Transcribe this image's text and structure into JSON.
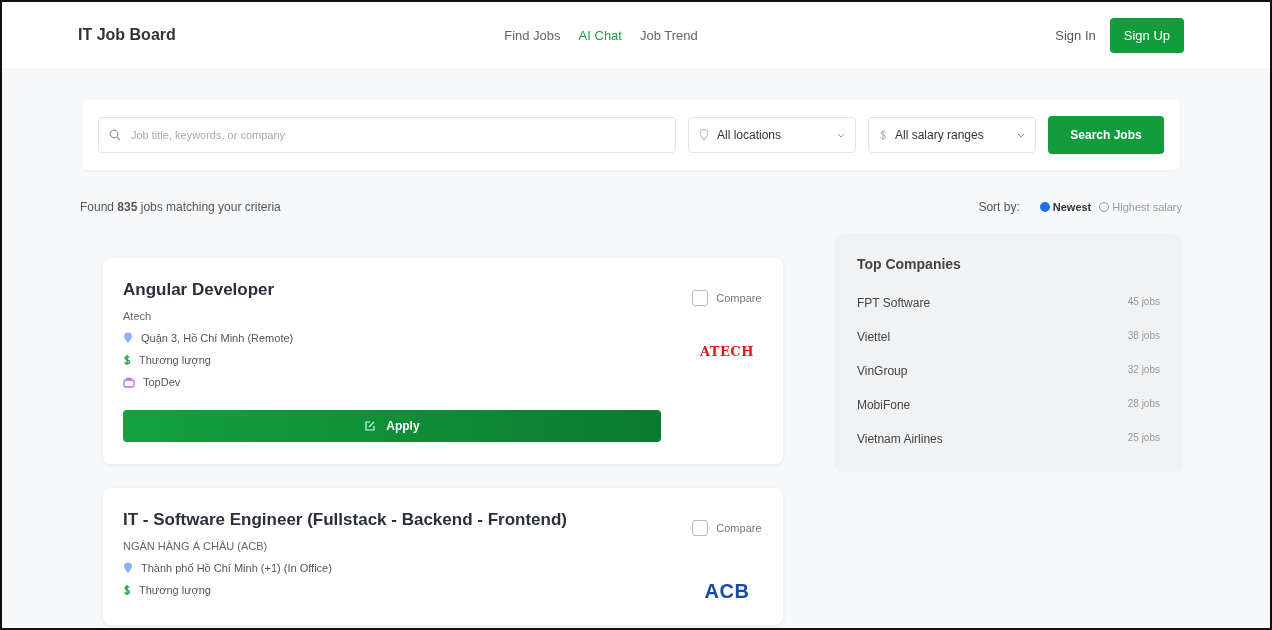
{
  "header": {
    "brand": "IT Job Board",
    "nav": [
      {
        "label": "Find Jobs",
        "selected": false
      },
      {
        "label": "AI Chat",
        "selected": true
      },
      {
        "label": "Job Trend",
        "selected": false
      }
    ],
    "sign_in": "Sign In",
    "sign_up": "Sign Up"
  },
  "search": {
    "placeholder": "Job title, keywords, or company",
    "location": "All locations",
    "salary": "All salary ranges",
    "button": "Search Jobs"
  },
  "results": {
    "prefix": "Found ",
    "count": "835",
    "suffix": " jobs matching your criteria",
    "sort_label": "Sort by:",
    "sort_options": [
      {
        "label": "Newest",
        "selected": true
      },
      {
        "label": "Highest salary",
        "selected": false
      }
    ]
  },
  "jobs": [
    {
      "title": "Angular Developer",
      "company": "Atech",
      "location": "Quận 3, Hồ Chí Minh (Remote)",
      "salary": "Thương lượng",
      "source": "TopDev",
      "apply": "Apply",
      "compare": "Compare",
      "compare_checked": false,
      "logo": "ATECH"
    },
    {
      "title": "IT - Software Engineer (Fullstack - Backend - Frontend)",
      "company": "NGÂN HÀNG Á CHÂU (ACB)",
      "location": "Thành phố Hồ Chí Minh (+1) (In Office)",
      "salary": "Thương lượng",
      "compare": "Compare",
      "compare_checked": false,
      "logo": "ACB"
    }
  ],
  "top_companies": {
    "title": "Top Companies",
    "items": [
      {
        "name": "FPT Software",
        "count": "45 jobs"
      },
      {
        "name": "Viettel",
        "count": "38 jobs"
      },
      {
        "name": "VinGroup",
        "count": "32 jobs"
      },
      {
        "name": "MobiFone",
        "count": "28 jobs"
      },
      {
        "name": "Vietnam Airlines",
        "count": "25 jobs"
      }
    ]
  }
}
